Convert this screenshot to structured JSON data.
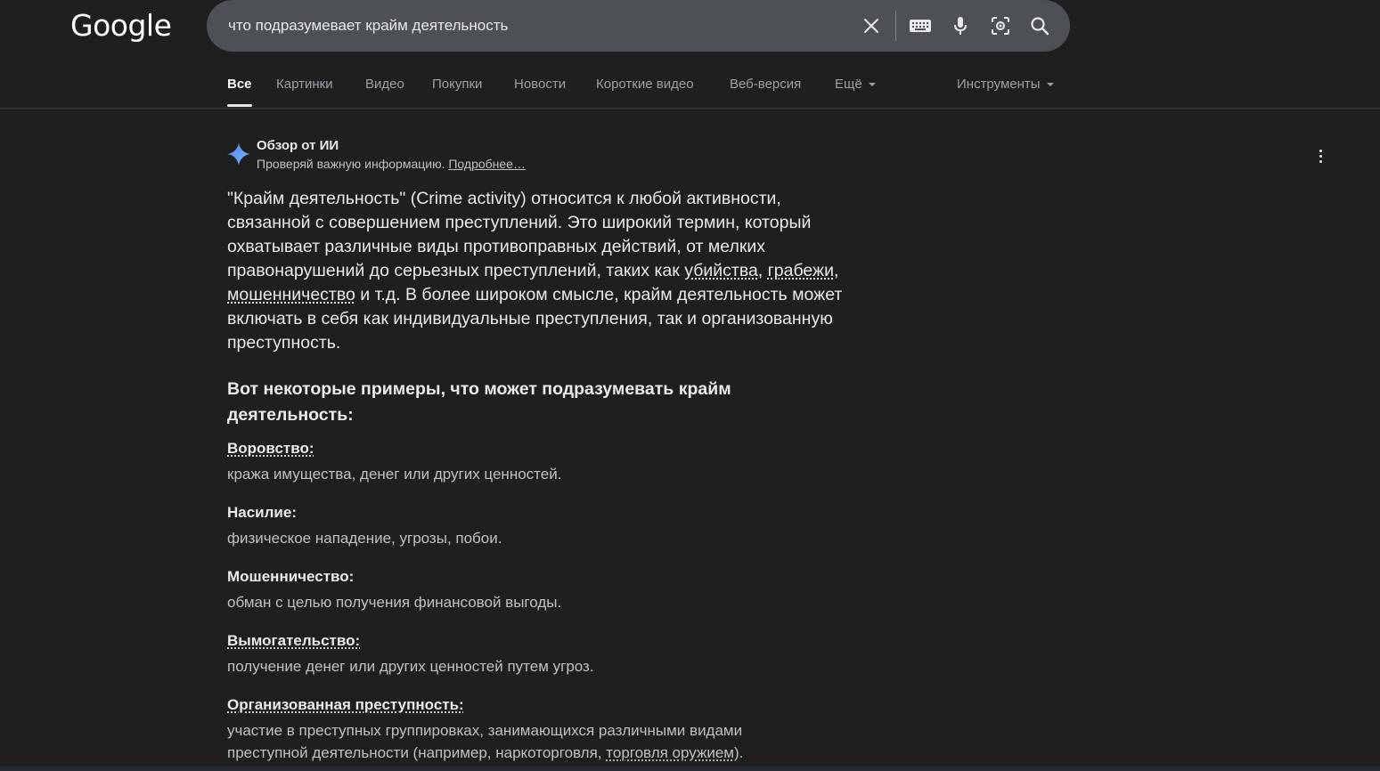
{
  "logo": "Google",
  "search": {
    "query": "что подразумевает крайм деятельность"
  },
  "icons": {
    "clear": "close-icon",
    "keyboard": "keyboard-icon",
    "voice": "microphone-icon",
    "lens": "camera-lens-icon",
    "search": "search-icon",
    "ai": "sparkle-icon",
    "more": "more-vertical-icon"
  },
  "tabs": [
    {
      "label": "Все",
      "active": true
    },
    {
      "label": "Картинки"
    },
    {
      "label": "Видео"
    },
    {
      "label": "Покупки"
    },
    {
      "label": "Новости"
    },
    {
      "label": "Короткие видео"
    },
    {
      "label": "Веб-версия"
    },
    {
      "label": "Ещё"
    }
  ],
  "tools": "Инструменты",
  "ai_overview": {
    "title": "Обзор от ИИ",
    "subtitle": "Проверяй важную информацию.",
    "more_link": "Подробнее…",
    "para_1": "\"Крайм деятельность\" (Crime activity) относится к любой активности, связанной с совершением преступлений. Это широкий термин, который охватывает различные виды противоправных действий, от мелких правонарушений до серьезных преступлений, таких как ",
    "link_murders": "убийства",
    "para_comma1": ", ",
    "link_robbery": "грабежи",
    "para_comma2": ", ",
    "link_fraud": "мошенничество",
    "para_2": " и т.д. В более широком смысле, крайм деятельность может включать в себя как индивидуальные преступления, так и организованную преступность.",
    "examples_heading": "Вот некоторые примеры, что может подразумевать крайм деятельность:",
    "items": [
      {
        "title": "Воровство:",
        "desc": "кража имущества, денег или других ценностей."
      },
      {
        "title": "Насилие:",
        "desc": "физическое нападение, угрозы, побои."
      },
      {
        "title": "Мошенничество:",
        "desc": "обман с целью получения финансовой выгоды."
      },
      {
        "title": "Вымогательство:",
        "desc": "получение денег или других ценностей путем угроз."
      },
      {
        "title": "Организованная преступность:",
        "desc_pre": "участие в преступных группировках, занимающихся различными видами преступной деятельности (например, наркоторговля, ",
        "desc_link": "торговля оружием",
        "desc_post": ")."
      }
    ]
  },
  "colors": {
    "background": "#1f1f1f",
    "searchbox": "#4d5156",
    "text": "#e8eaed",
    "muted": "#9aa0a6",
    "ai_accent": "#8ab4f8"
  }
}
